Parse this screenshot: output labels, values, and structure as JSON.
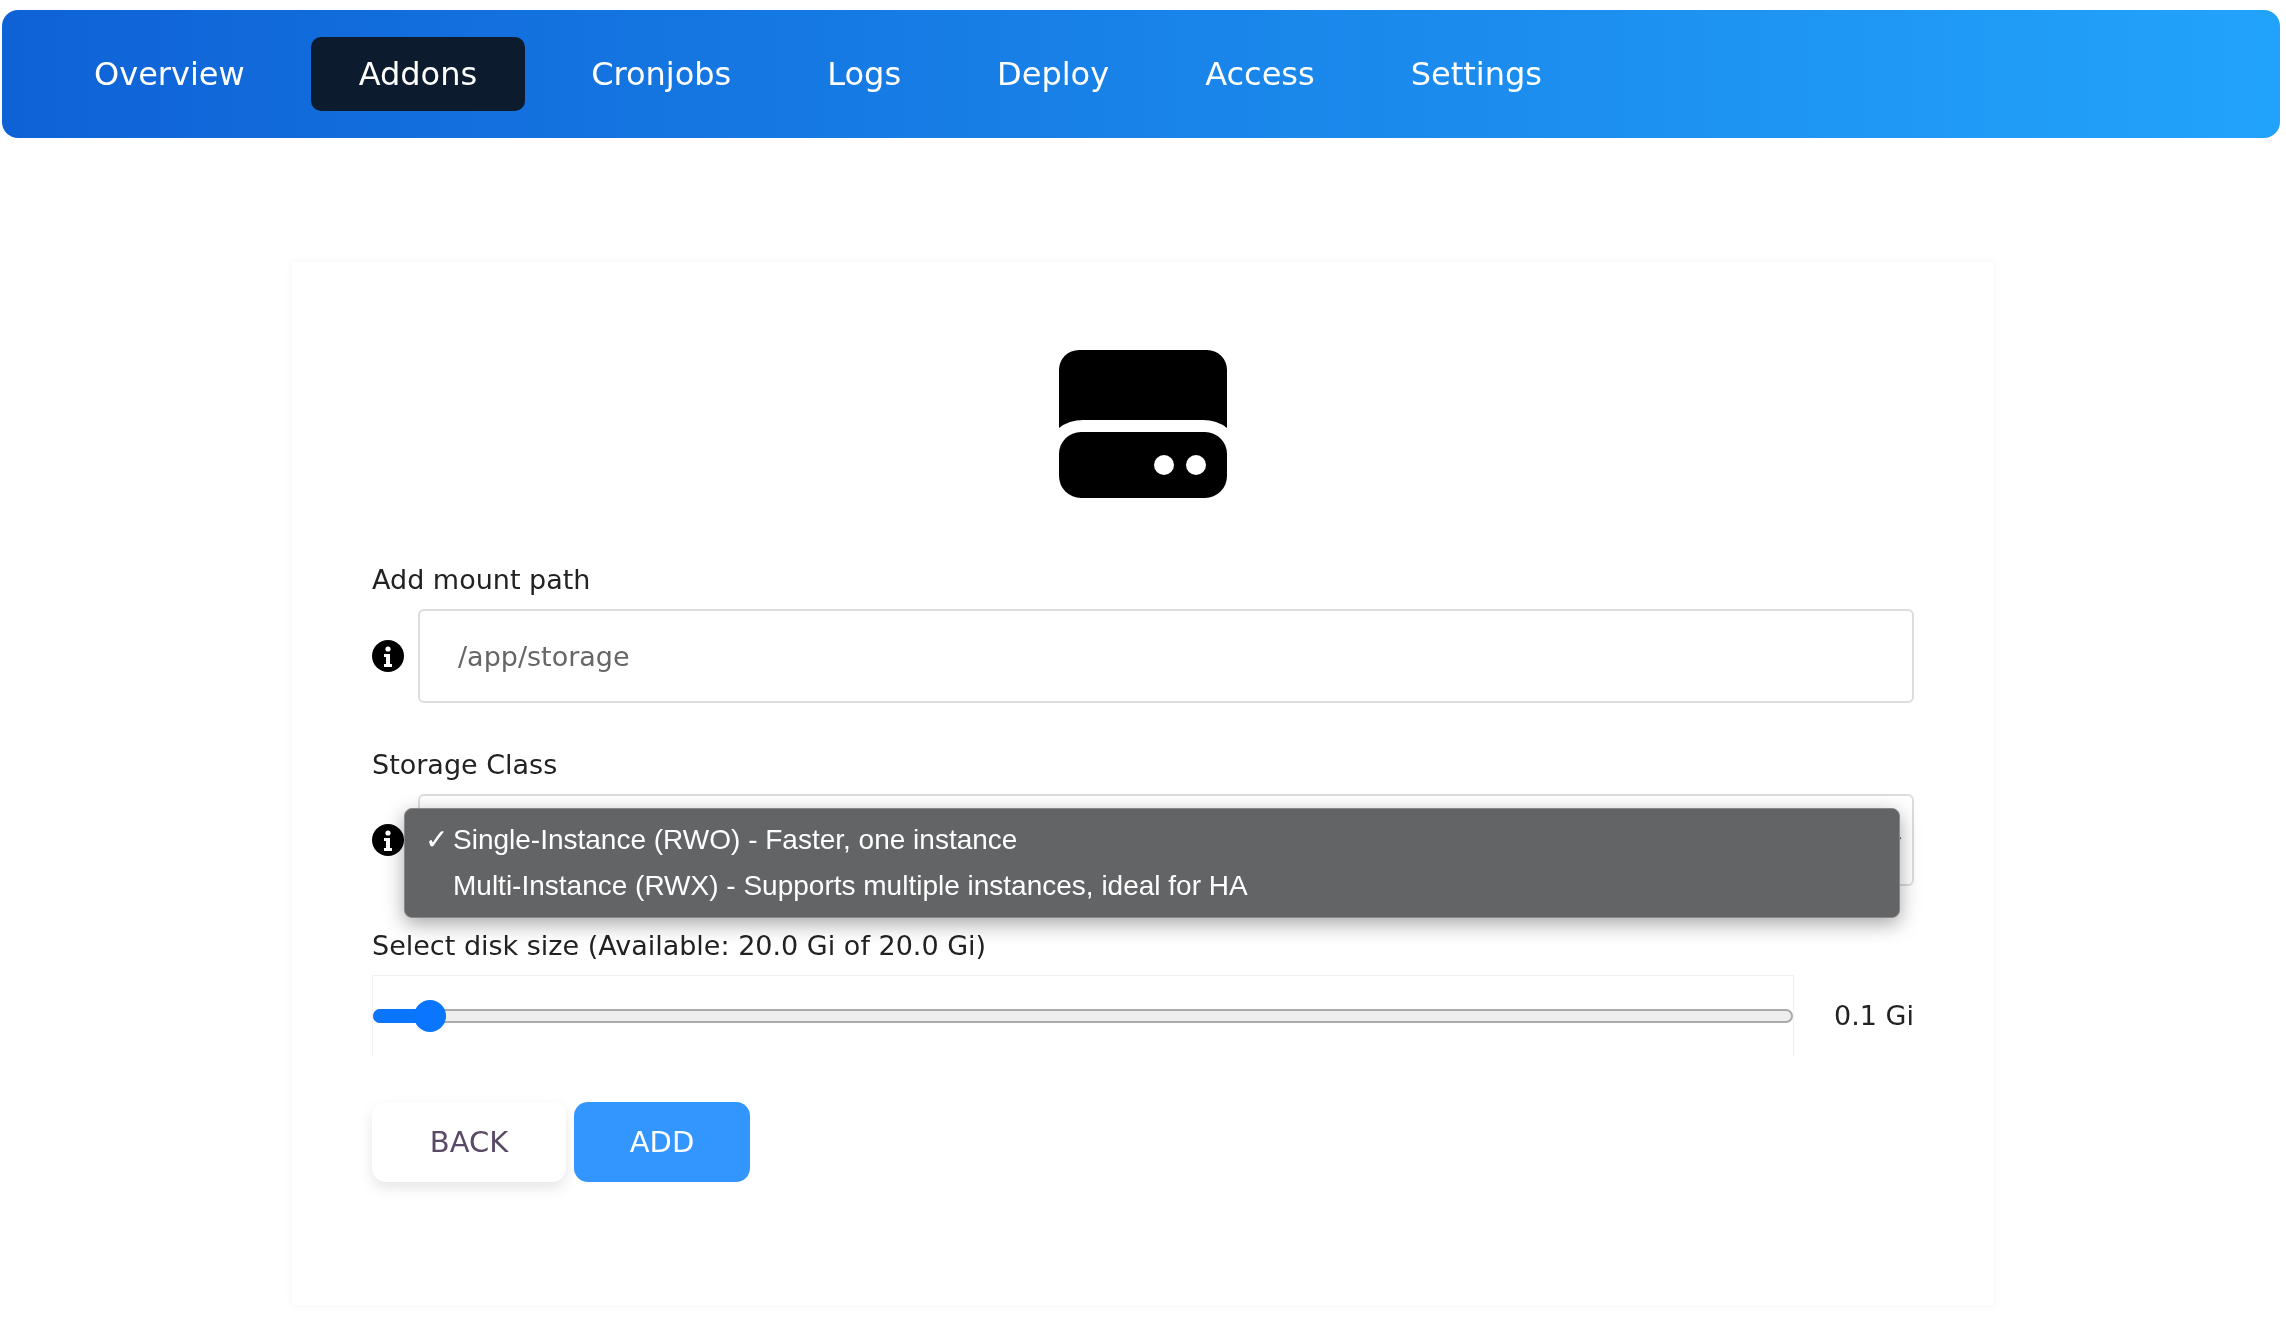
{
  "tabs": [
    {
      "label": "Overview",
      "selected": false
    },
    {
      "label": "Addons",
      "selected": true
    },
    {
      "label": "Cronjobs",
      "selected": false
    },
    {
      "label": "Logs",
      "selected": false
    },
    {
      "label": "Deploy",
      "selected": false
    },
    {
      "label": "Access",
      "selected": false
    },
    {
      "label": "Settings",
      "selected": false
    }
  ],
  "mount_path": {
    "label": "Add mount path",
    "placeholder": "/app/storage"
  },
  "storage_class": {
    "label": "Storage Class",
    "check": "✓",
    "options": [
      {
        "label": "Single-Instance (RWO) - Faster, one instance",
        "selected": true
      },
      {
        "label": "Multi-Instance (RWX) - Supports multiple instances, ideal for HA",
        "selected": false
      }
    ]
  },
  "disk_size": {
    "label": "Select disk size (Available: 20.0 Gi of 20.0 Gi)",
    "level": 0.04,
    "reading": "0.1 Gi"
  },
  "buttons": [
    {
      "label": "BACK",
      "kind": "secondary"
    },
    {
      "label": "ADD",
      "kind": "primary"
    }
  ]
}
